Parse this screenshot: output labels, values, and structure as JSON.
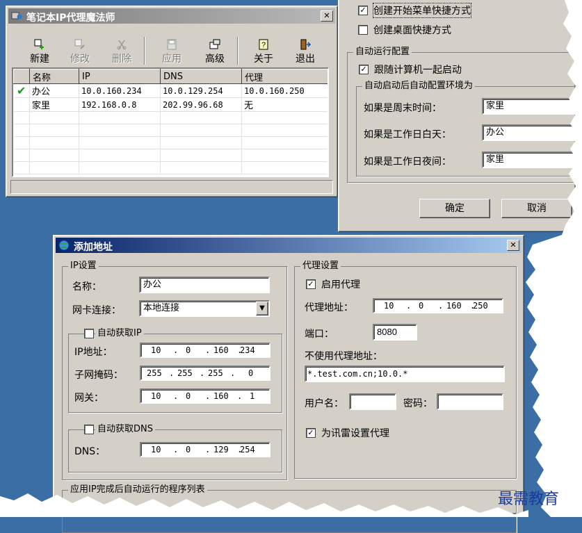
{
  "main_window": {
    "title": "笔记本IP代理魔法师",
    "close": "✕",
    "toolbar": [
      {
        "label": "新建",
        "icon": "new-icon",
        "enabled": true
      },
      {
        "label": "修改",
        "icon": "edit-icon",
        "enabled": false
      },
      {
        "label": "删除",
        "icon": "delete-icon",
        "enabled": false
      },
      {
        "label": "应用",
        "icon": "apply-icon",
        "enabled": false
      },
      {
        "label": "高级",
        "icon": "advanced-icon",
        "enabled": true
      },
      {
        "label": "关于",
        "icon": "about-icon",
        "enabled": true
      },
      {
        "label": "退出",
        "icon": "exit-icon",
        "enabled": true
      }
    ],
    "columns": [
      "名称",
      "IP",
      "DNS",
      "代理"
    ],
    "rows": [
      {
        "active": true,
        "name": "办公",
        "ip": "10.0.160.234",
        "dns": "10.0.129.254",
        "proxy": "10.0.160.250"
      },
      {
        "active": false,
        "name": "家里",
        "ip": "192.168.0.8",
        "dns": "202.99.96.68",
        "proxy": "无"
      }
    ]
  },
  "settings_window": {
    "check_start_menu": "创建开始菜单快捷方式",
    "check_desktop": "创建桌面快捷方式",
    "auto_config_group": "自动运行配置",
    "check_startup": "跟随计算机一起启动",
    "auto_env_group": "自动启动后自动配置环境为",
    "weekend_label": "如果是周末时间：",
    "weekend_value": "家里",
    "workday_label": "如果是工作日白天：",
    "workday_value": "办公",
    "night_label": "如果是工作日夜间：",
    "night_value": "家里",
    "ok": "确定",
    "cancel": "取消"
  },
  "add_dialog": {
    "title": "添加地址",
    "close": "✕",
    "ip_group": "IP设置",
    "name_label": "名称：",
    "name_value": "办公",
    "nic_label": "网卡连接：",
    "nic_value": "本地连接",
    "auto_ip": "自动获取IP",
    "ip_label": "IP地址：",
    "ip_octets": [
      "10",
      "0",
      "160",
      "234"
    ],
    "mask_label": "子网掩码：",
    "mask_octets": [
      "255",
      "255",
      "255",
      "0"
    ],
    "gateway_label": "网关：",
    "gateway_octets": [
      "10",
      "0",
      "160",
      "1"
    ],
    "auto_dns": "自动获取DNS",
    "dns_label": "DNS：",
    "dns_octets": [
      "10",
      "0",
      "129",
      "254"
    ],
    "proxy_group": "代理设置",
    "enable_proxy": "启用代理",
    "proxy_addr_label": "代理地址：",
    "proxy_octets": [
      "10",
      "0",
      "160",
      "250"
    ],
    "port_label": "端口：",
    "port_value": "8080",
    "bypass_label": "不使用代理地址：",
    "bypass_value": "*.test.com.cn;10.0.*",
    "user_label": "用户名：",
    "user_value": "",
    "password_label": "密码：",
    "password_value": "",
    "thunder_proxy": "为讯雷设置代理",
    "programs_group": "应用IP完成后自动运行的程序列表"
  },
  "watermark": "最需教育",
  "colors": {
    "desktop": "#3a6ea5",
    "window": "#d4d0c8",
    "title_active": "#0a246a",
    "title_inactive": "#7b7b7b",
    "check_green": "#1a9a1a",
    "watermark": "#1a3aa0"
  }
}
